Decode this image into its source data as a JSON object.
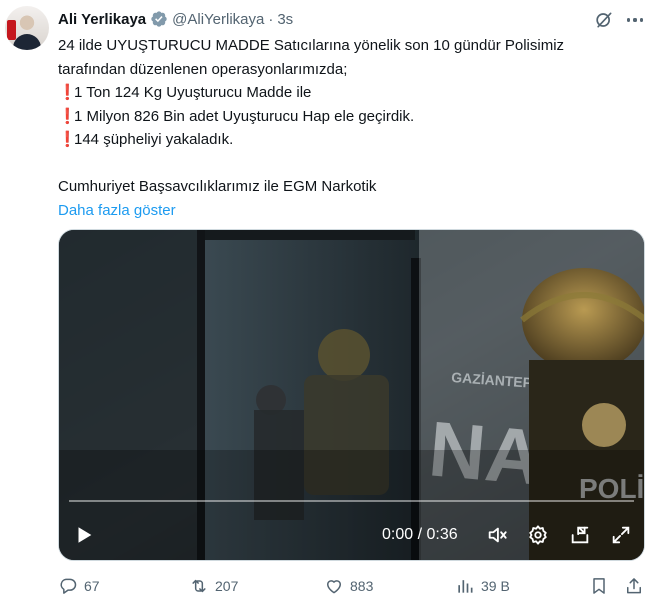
{
  "tweet": {
    "author_name": "Ali Yerlikaya",
    "handle": "@AliYerlikaya",
    "separator": "·",
    "time": "3s",
    "lines": [
      "24 ilde UYUŞTURUCU MADDE Satıcılarına yönelik son 10 gündür Polisimiz",
      "tarafından düzenlenen operasyonlarımızda;"
    ],
    "bullet_mark": "❗",
    "bullets": [
      "1 Ton 124 Kg Uyuşturucu Madde ile",
      "1 Milyon 826 Bin adet Uyuşturucu Hap ele geçirdik.",
      "144 şüpheliyi yakaladık."
    ],
    "footer_line": "Cumhuriyet Başsavcılıklarımız ile EGM Narkotik",
    "show_more": "Daha fazla göster"
  },
  "video": {
    "current_time": "0:00",
    "time_separator": "/",
    "duration": "0:36",
    "progress": 0,
    "overlay_text": {
      "city": "GAZİANTEP",
      "large": "NAR",
      "small": "POLİS"
    }
  },
  "actions": {
    "replies": "67",
    "reposts": "207",
    "likes": "883",
    "views": "39 B"
  },
  "colors": {
    "accent": "#1d9bf0",
    "text": "#0f1419",
    "muted": "#536471",
    "alert": "#e0212e"
  },
  "icons": [
    "verified-badge-icon",
    "grok-icon",
    "more-icon",
    "play-icon",
    "volume-icon",
    "settings-icon",
    "pip-icon",
    "fullscreen-icon",
    "reply-icon",
    "repost-icon",
    "like-icon",
    "views-icon",
    "bookmark-icon",
    "share-icon"
  ]
}
